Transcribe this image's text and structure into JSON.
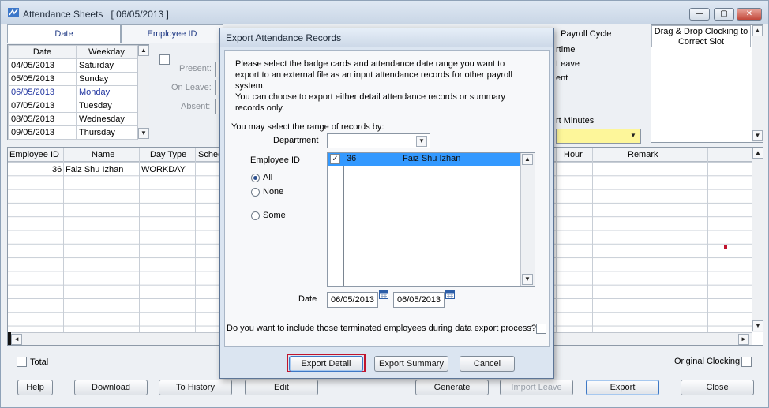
{
  "window": {
    "title": "Attendance Sheets",
    "title_date": "[ 06/05/2013 ]",
    "minimize": "—",
    "restore": "▢",
    "close": "✕"
  },
  "tabs": {
    "date": "Date",
    "employee_id": "Employee ID"
  },
  "date_table": {
    "headers": [
      "Date",
      "Weekday"
    ],
    "rows": [
      [
        "04/05/2013",
        "Saturday"
      ],
      [
        "05/05/2013",
        "Sunday"
      ],
      [
        "06/05/2013",
        "Monday"
      ],
      [
        "07/05/2013",
        "Tuesday"
      ],
      [
        "08/05/2013",
        "Wednesday"
      ],
      [
        "09/05/2013",
        "Thursday"
      ]
    ]
  },
  "status_labels": {
    "present": "Present:",
    "on_leave": "On Leave:",
    "absent": "Absent:"
  },
  "right_labels": {
    "payroll_cycle": "Payroll Cycle",
    "overtime": "rtime",
    "leave": "Leave",
    "ent": "ent",
    "minutes": "rt Minutes"
  },
  "drag_drop": {
    "title": "Drag & Drop Clocking to Correct Slot"
  },
  "grid": {
    "headers": [
      "Employee ID",
      "Name",
      "Day Type",
      "Sched",
      "Hour",
      "Remark"
    ],
    "row": {
      "employee_id": "36",
      "name": "Faiz Shu Izhan",
      "day_type": "WORKDAY"
    }
  },
  "bottom": {
    "total": "Total",
    "original_clocking": "Original Clocking",
    "buttons": {
      "help": "Help",
      "download": "Download",
      "to_history": "To History",
      "edit": "Edit",
      "generate": "Generate",
      "import_leave": "Import Leave",
      "export": "Export",
      "close": "Close"
    }
  },
  "dialog": {
    "title": "Export Attendance Records",
    "instructions": [
      "Please select the badge cards and attendance date range you want to",
      "export to an external file as an input attendance records for other payroll",
      "system.",
      "You can choose to export either detail attendance records or summary",
      "records only."
    ],
    "range_prompt": "You may select the range of records by:",
    "department_label": "Department",
    "department_value": "",
    "employee_id_label": "Employee ID",
    "radio_all": "All",
    "radio_none": "None",
    "radio_some": "Some",
    "employee_list": [
      {
        "id": "36",
        "name": "Faiz Shu Izhan",
        "checked": true
      }
    ],
    "date_label": "Date",
    "date_from": "06/05/2013",
    "date_to": "06/05/2013",
    "terminated_question": "Do you want to include those terminated employees during data export process?",
    "buttons": {
      "export_detail": "Export Detail",
      "export_summary": "Export Summary",
      "cancel": "Cancel"
    }
  },
  "colors": {
    "selection": "#3399ff",
    "highlight_border": "#c0142d",
    "yellow_field": "#fdf69a",
    "accent_text": "#2135a0"
  },
  "icons": {
    "calendar": "calendar-icon",
    "check": "✓",
    "up": "▲",
    "down": "▼",
    "left": "◄",
    "right": "►",
    "dropdown": "▼"
  }
}
